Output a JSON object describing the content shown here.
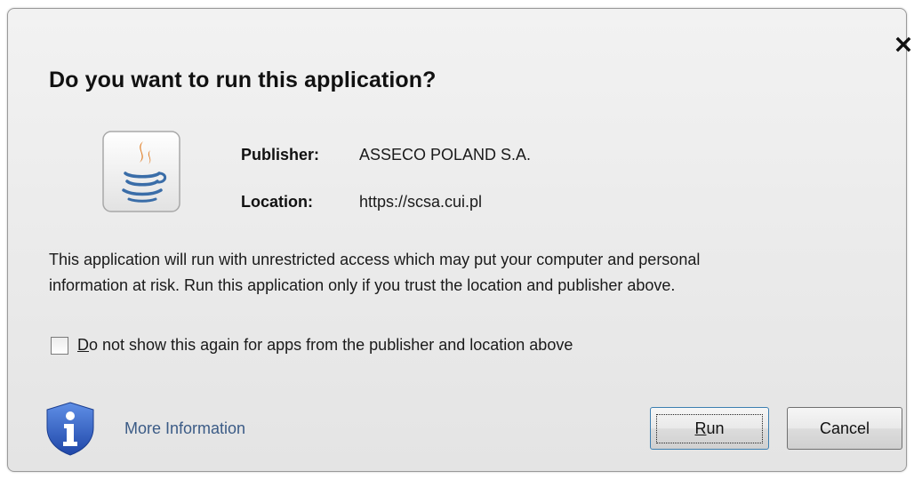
{
  "dialog": {
    "title": "Do you want to run this application?",
    "close_icon": "close-icon",
    "app_icon": "java-coffee-cup-icon"
  },
  "details": {
    "publisher_label": "Publisher:",
    "publisher_value": "ASSECO POLAND S.A.",
    "location_label": "Location:",
    "location_value": "https://scsa.cui.pl"
  },
  "warning": {
    "line1": "This application will run with unrestricted access which may put your computer and personal",
    "line2": "information at risk. Run this application only if you trust the location and publisher above."
  },
  "checkbox": {
    "mnemonic": "D",
    "label_rest": "o not show this again for apps from the publisher and location above",
    "checked": false
  },
  "footer": {
    "info_icon": "info-shield-icon",
    "more_info": "More Information",
    "run_mnemonic": "R",
    "run_rest": "un",
    "cancel": "Cancel"
  },
  "colors": {
    "link": "#3b5b86",
    "shield_blue": "#2f5ec4",
    "java_orange": "#e07a20",
    "java_blue": "#3a6da8"
  }
}
